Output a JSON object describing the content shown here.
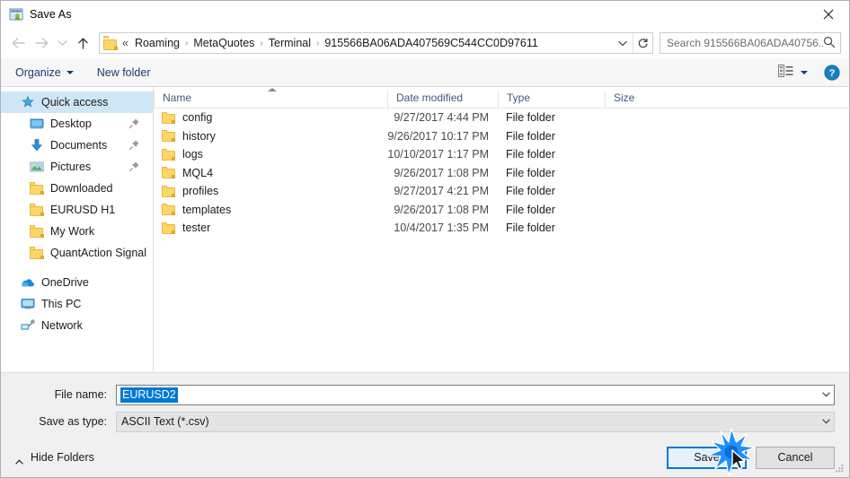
{
  "window": {
    "title": "Save As",
    "title_icon": "save-as-icon",
    "close_label": "close-icon"
  },
  "nav": {
    "back": "back-arrow-icon",
    "forward": "forward-arrow-icon",
    "recent": "recent-locations-chevron-icon",
    "up": "up-arrow-icon",
    "breadcrumb_prefix": "«",
    "breadcrumbs": [
      "Roaming",
      "MetaQuotes",
      "Terminal",
      "915566BA06ADA407569C544CC0D97611"
    ],
    "separator": "›",
    "dropdown_icon": "chevron-down-icon",
    "refresh_icon": "refresh-icon"
  },
  "search": {
    "placeholder": "Search 915566BA06ADA40756...",
    "value": "",
    "icon": "search-icon"
  },
  "toolbar": {
    "organize_label": "Organize",
    "new_folder_label": "New folder",
    "view_icon": "view-layout-icon",
    "view_dropdown_icon": "chevron-down-icon",
    "help_icon": "help-icon"
  },
  "sidebar": {
    "items": [
      {
        "label": "Quick access",
        "icon": "quick-access-star-icon",
        "selected": true,
        "indent": false,
        "pinned": false
      },
      {
        "label": "Desktop",
        "icon": "desktop-icon",
        "selected": false,
        "indent": true,
        "pinned": true
      },
      {
        "label": "Documents",
        "icon": "documents-download-icon",
        "selected": false,
        "indent": true,
        "pinned": true
      },
      {
        "label": "Pictures",
        "icon": "pictures-icon",
        "selected": false,
        "indent": true,
        "pinned": true
      },
      {
        "label": "Downloaded",
        "icon": "folder-icon",
        "selected": false,
        "indent": true,
        "pinned": false
      },
      {
        "label": "EURUSD H1",
        "icon": "folder-icon",
        "selected": false,
        "indent": true,
        "pinned": false
      },
      {
        "label": "My Work",
        "icon": "folder-icon",
        "selected": false,
        "indent": true,
        "pinned": false
      },
      {
        "label": "QuantAction Signal",
        "icon": "folder-icon",
        "selected": false,
        "indent": true,
        "pinned": false
      }
    ],
    "roots": [
      {
        "label": "OneDrive",
        "icon": "onedrive-cloud-icon"
      },
      {
        "label": "This PC",
        "icon": "this-pc-icon"
      },
      {
        "label": "Network",
        "icon": "network-icon"
      }
    ]
  },
  "filelist": {
    "columns": [
      "Name",
      "Date modified",
      "Type",
      "Size"
    ],
    "sort_column": "Name",
    "sort_direction": "ascending",
    "rows": [
      {
        "name": "config",
        "date": "9/27/2017 4:44 PM",
        "type": "File folder",
        "size": ""
      },
      {
        "name": "history",
        "date": "9/26/2017 10:17 PM",
        "type": "File folder",
        "size": ""
      },
      {
        "name": "logs",
        "date": "10/10/2017 1:17 PM",
        "type": "File folder",
        "size": ""
      },
      {
        "name": "MQL4",
        "date": "9/26/2017 1:08 PM",
        "type": "File folder",
        "size": ""
      },
      {
        "name": "profiles",
        "date": "9/27/2017 4:21 PM",
        "type": "File folder",
        "size": ""
      },
      {
        "name": "templates",
        "date": "9/26/2017 1:08 PM",
        "type": "File folder",
        "size": ""
      },
      {
        "name": "tester",
        "date": "10/4/2017 1:35 PM",
        "type": "File folder",
        "size": ""
      }
    ]
  },
  "form": {
    "filename_label": "File name:",
    "filename_value": "EURUSD2",
    "filename_selected": true,
    "filetype_label": "Save as type:",
    "filetype_value": "ASCII Text (*.csv)"
  },
  "footer": {
    "hide_folders_label": "Hide Folders",
    "hide_folders_icon": "chevron-up-icon",
    "save_label": "Save",
    "cancel_label": "Cancel",
    "resize_grip": "resize-grip-icon",
    "click_effect": "click-burst-icon",
    "cursor": "mouse-pointer-icon"
  },
  "colors": {
    "accent": "#0078d7",
    "selection": "#cfe6f7",
    "folder": "#fcd667",
    "link": "#1a3c6e",
    "burst": "#1e90ff"
  }
}
